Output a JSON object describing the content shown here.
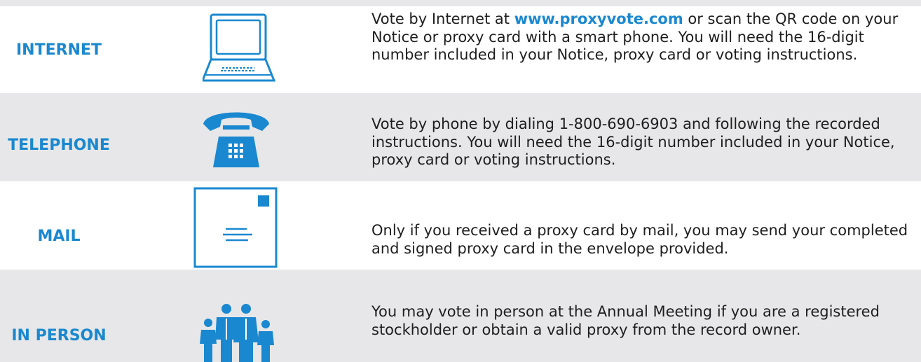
{
  "colors": {
    "accent": "#1a88d0",
    "row_shade": "#e7e7e9",
    "body_text": "#1e1e1e"
  },
  "methods": [
    {
      "label": "INTERNET",
      "icon": "laptop-icon",
      "text_before": "Vote by Internet at ",
      "link": "www.proxyvote.com",
      "text_after": " or scan the QR code on your Notice or proxy card with a smart phone. You will need the 16-digit number included in your Notice, proxy card or voting instructions."
    },
    {
      "label": "TELEPHONE",
      "icon": "telephone-icon",
      "text": "Vote by phone by dialing 1-800-690-6903 and following the recorded instructions. You will need the 16-digit number included in your Notice, proxy card or voting instructions."
    },
    {
      "label": "MAIL",
      "icon": "envelope-icon",
      "text": "Only if you received a proxy card by mail, you may send your completed and signed proxy card in the envelope provided."
    },
    {
      "label": "IN PERSON",
      "icon": "people-icon",
      "text": "You may vote in person at the Annual Meeting if you are a registered stockholder or obtain a valid proxy from the record owner."
    }
  ]
}
